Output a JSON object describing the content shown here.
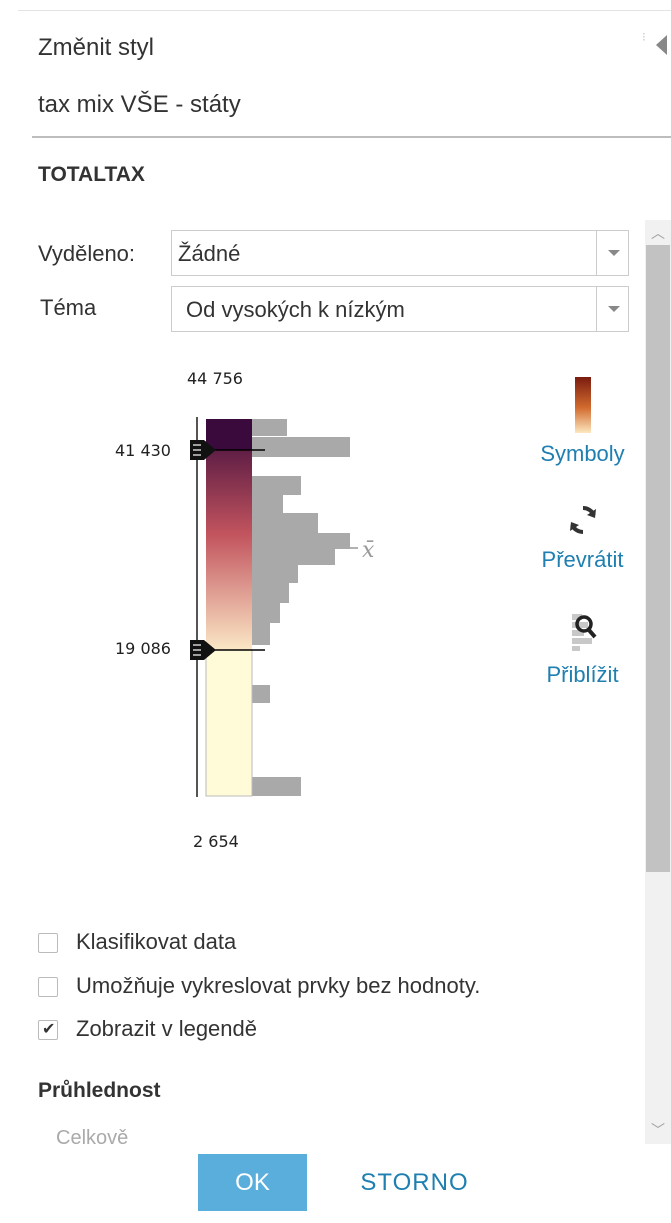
{
  "panel": {
    "title": "Změnit styl",
    "layer_name": "tax mix VŠE - státy",
    "field_name": "TOTALTAX"
  },
  "selection": {
    "label": "Vyděleno:",
    "value": "Žádné"
  },
  "theme": {
    "label": "Téma",
    "value": "Od vysokých k nízkým"
  },
  "slider": {
    "max_label": "44 756",
    "min_label": "2 654",
    "upper_handle_label": "41 430",
    "lower_handle_label": "19 086",
    "max": 44756,
    "min": 2654,
    "upper_handle": 41430,
    "lower_handle": 19086,
    "mean_symbol": "x̄",
    "ramp_colors": {
      "dark": "#3b0a3c",
      "mid": "#c2545e",
      "light": "#fbe7c6",
      "pale": "#fffad8"
    },
    "histogram_color": "#a9a9a9"
  },
  "tools": {
    "symbols": {
      "label": "Symboly",
      "icon": "color-ramp-icon"
    },
    "flip": {
      "label": "Převrátit",
      "icon": "refresh-icon"
    },
    "zoom": {
      "label": "Přiblížit",
      "icon": "zoom-histogram-icon"
    }
  },
  "options": [
    {
      "label": "Klasifikovat data",
      "checked": false
    },
    {
      "label": "Umožňuje vykreslovat prvky bez hodnoty.",
      "checked": false
    },
    {
      "label": "Zobrazit v legendě",
      "checked": true
    }
  ],
  "transparency": {
    "heading": "Průhlednost",
    "sub_label": "Celkově"
  },
  "actions": {
    "ok": "OK",
    "cancel": "STORNO"
  },
  "colors": {
    "accent": "#1f7fb0",
    "ok_button": "#5aaedc"
  }
}
